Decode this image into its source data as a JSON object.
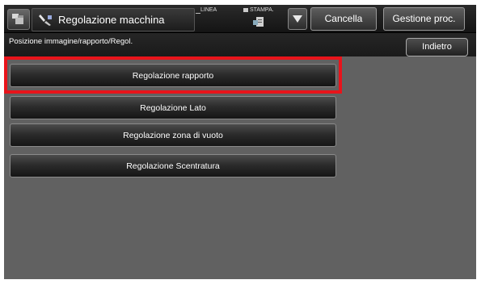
{
  "header": {
    "title": "Regolazione macchina",
    "status_linea": "LINEA",
    "status_stampa": "STAMPA.",
    "cancel_label": "Cancella",
    "job_manager_label": "Gestione proc."
  },
  "pathbar": {
    "breadcrumb": "Posizione immagine/rapporto/Regol.",
    "back_label": "Indietro"
  },
  "menu": {
    "items": [
      {
        "label": "Regolazione rapporto"
      },
      {
        "label": "Regolazione Lato"
      },
      {
        "label": "Regolazione zona di vuoto"
      },
      {
        "label": "Regolazione Scentratura"
      }
    ],
    "highlight_color": "#e8141b"
  },
  "icons": [
    "machine-mode-icon",
    "tool-icon",
    "print-status-icon",
    "dropdown-arrow-icon"
  ]
}
